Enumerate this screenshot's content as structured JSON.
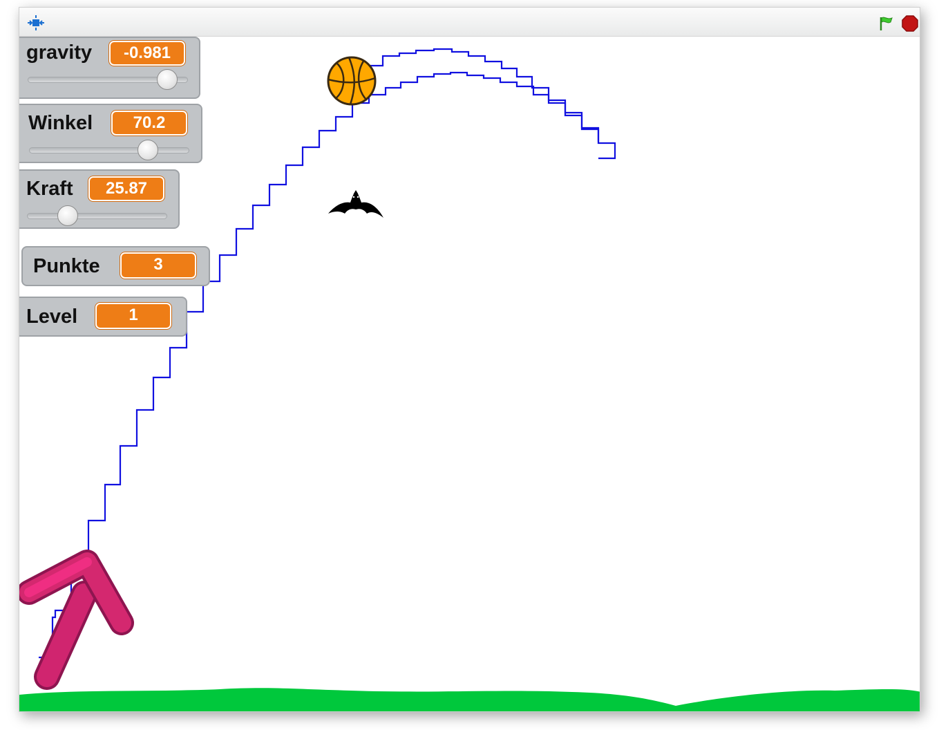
{
  "titlebar": {
    "fullscreen_icon": "fullscreen-toggle-icon",
    "green_flag_icon": "green-flag-icon",
    "stop_icon": "stop-sign-icon"
  },
  "monitors": {
    "gravity": {
      "label": "gravity",
      "value": "-0.981",
      "slider_level": 0.87
    },
    "winkel": {
      "label": "Winkel",
      "value": "70.2",
      "slider_level": 0.74
    },
    "kraft": {
      "label": "Kraft",
      "value": "25.87",
      "slider_level": 0.29
    },
    "punkte": {
      "label": "Punkte",
      "value": "3"
    },
    "level": {
      "label": "Level",
      "value": "1"
    }
  },
  "sprites": {
    "ball": "basketball-sprite",
    "bat": "bat-sprite",
    "arrow": "launch-arrow-sprite",
    "ground": "grass-ground"
  },
  "colors": {
    "trajectory": "#1010e0",
    "monitor_value": "#ee7d16",
    "grass": "#00c83c",
    "arrow": "#c21f6c",
    "ball": "#ffa500",
    "flag": "#3fcc2f",
    "stop": "#c21414"
  }
}
